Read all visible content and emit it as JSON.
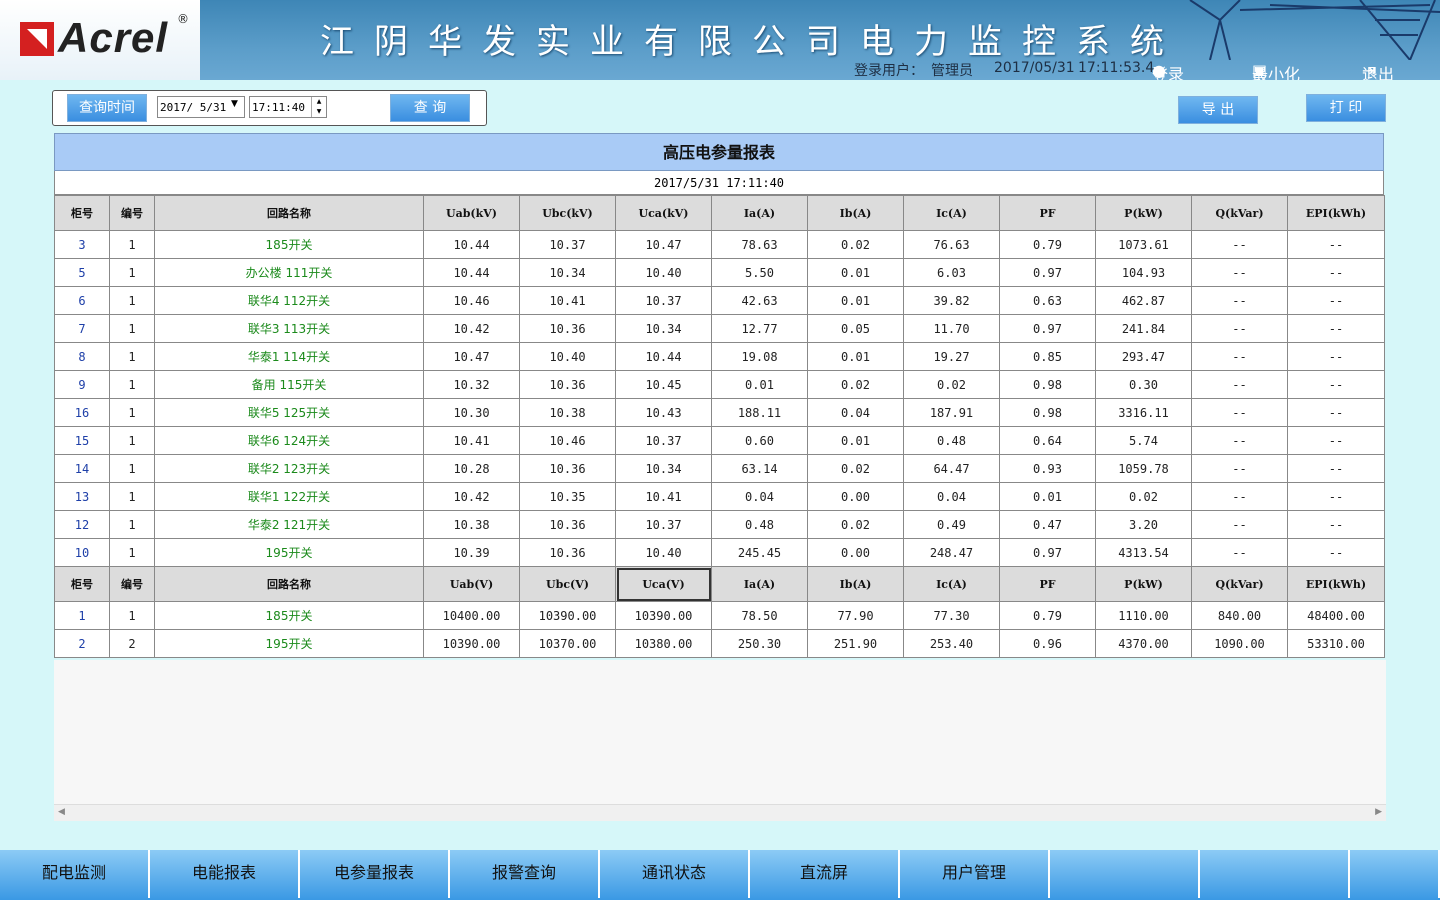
{
  "header": {
    "logo_text": "Acrel",
    "logo_reg": "®",
    "title": "江阴华发实业有限公司电力监控系统",
    "login_user_label": "登录用户：",
    "login_user": "管理员",
    "date": "2017/05/31",
    "time": "17:11:53.4",
    "login_btn": "登录",
    "minimize_btn": "最小化",
    "exit_btn": "退出"
  },
  "query": {
    "label": "查询时间",
    "date_value": "2017/ 5/31",
    "time_value": "17:11:40",
    "query_btn": "查 询"
  },
  "toolbar": {
    "export_btn": "导 出",
    "print_btn": "打 印"
  },
  "report": {
    "title": "高压电参量报表",
    "datetime": "2017/5/31  17:11:40",
    "headers1": [
      "柜号",
      "编号",
      "回路名称",
      "Uab(kV)",
      "Ubc(kV)",
      "Uca(kV)",
      "Ia(A)",
      "Ib(A)",
      "Ic(A)",
      "PF",
      "P(kW)",
      "Q(kVar)",
      "EPI(kWh)"
    ],
    "rows1": [
      [
        "3",
        "1",
        "185开关",
        "10.44",
        "10.37",
        "10.47",
        "78.63",
        "0.02",
        "76.63",
        "0.79",
        "1073.61",
        "--",
        "--"
      ],
      [
        "5",
        "1",
        "办公楼  111开关",
        "10.44",
        "10.34",
        "10.40",
        "5.50",
        "0.01",
        "6.03",
        "0.97",
        "104.93",
        "--",
        "--"
      ],
      [
        "6",
        "1",
        "联华4  112开关",
        "10.46",
        "10.41",
        "10.37",
        "42.63",
        "0.01",
        "39.82",
        "0.63",
        "462.87",
        "--",
        "--"
      ],
      [
        "7",
        "1",
        "联华3  113开关",
        "10.42",
        "10.36",
        "10.34",
        "12.77",
        "0.05",
        "11.70",
        "0.97",
        "241.84",
        "--",
        "--"
      ],
      [
        "8",
        "1",
        "华泰1  114开关",
        "10.47",
        "10.40",
        "10.44",
        "19.08",
        "0.01",
        "19.27",
        "0.85",
        "293.47",
        "--",
        "--"
      ],
      [
        "9",
        "1",
        "备用  115开关",
        "10.32",
        "10.36",
        "10.45",
        "0.01",
        "0.02",
        "0.02",
        "0.98",
        "0.30",
        "--",
        "--"
      ],
      [
        "16",
        "1",
        "联华5  125开关",
        "10.30",
        "10.38",
        "10.43",
        "188.11",
        "0.04",
        "187.91",
        "0.98",
        "3316.11",
        "--",
        "--"
      ],
      [
        "15",
        "1",
        "联华6  124开关",
        "10.41",
        "10.46",
        "10.37",
        "0.60",
        "0.01",
        "0.48",
        "0.64",
        "5.74",
        "--",
        "--"
      ],
      [
        "14",
        "1",
        "联华2  123开关",
        "10.28",
        "10.36",
        "10.34",
        "63.14",
        "0.02",
        "64.47",
        "0.93",
        "1059.78",
        "--",
        "--"
      ],
      [
        "13",
        "1",
        "联华1  122开关",
        "10.42",
        "10.35",
        "10.41",
        "0.04",
        "0.00",
        "0.04",
        "0.01",
        "0.02",
        "--",
        "--"
      ],
      [
        "12",
        "1",
        "华泰2  121开关",
        "10.38",
        "10.36",
        "10.37",
        "0.48",
        "0.02",
        "0.49",
        "0.47",
        "3.20",
        "--",
        "--"
      ],
      [
        "10",
        "1",
        "195开关",
        "10.39",
        "10.36",
        "10.40",
        "245.45",
        "0.00",
        "248.47",
        "0.97",
        "4313.54",
        "--",
        "--"
      ]
    ],
    "headers2": [
      "柜号",
      "编号",
      "回路名称",
      "Uab(V)",
      "Ubc(V)",
      "Uca(V)",
      "Ia(A)",
      "Ib(A)",
      "Ic(A)",
      "PF",
      "P(kW)",
      "Q(kVar)",
      "EPI(kWh)"
    ],
    "rows2": [
      [
        "1",
        "1",
        "185开关",
        "10400.00",
        "10390.00",
        "10390.00",
        "78.50",
        "77.90",
        "77.30",
        "0.79",
        "1110.00",
        "840.00",
        "48400.00"
      ],
      [
        "2",
        "2",
        "195开关",
        "10390.00",
        "10370.00",
        "10380.00",
        "250.30",
        "251.90",
        "253.40",
        "0.96",
        "4370.00",
        "1090.00",
        "53310.00"
      ]
    ]
  },
  "nav": [
    "配电监测",
    "电能报表",
    "电参量报表",
    "报警查询",
    "通讯状态",
    "直流屏",
    "用户管理",
    "",
    "",
    ""
  ]
}
